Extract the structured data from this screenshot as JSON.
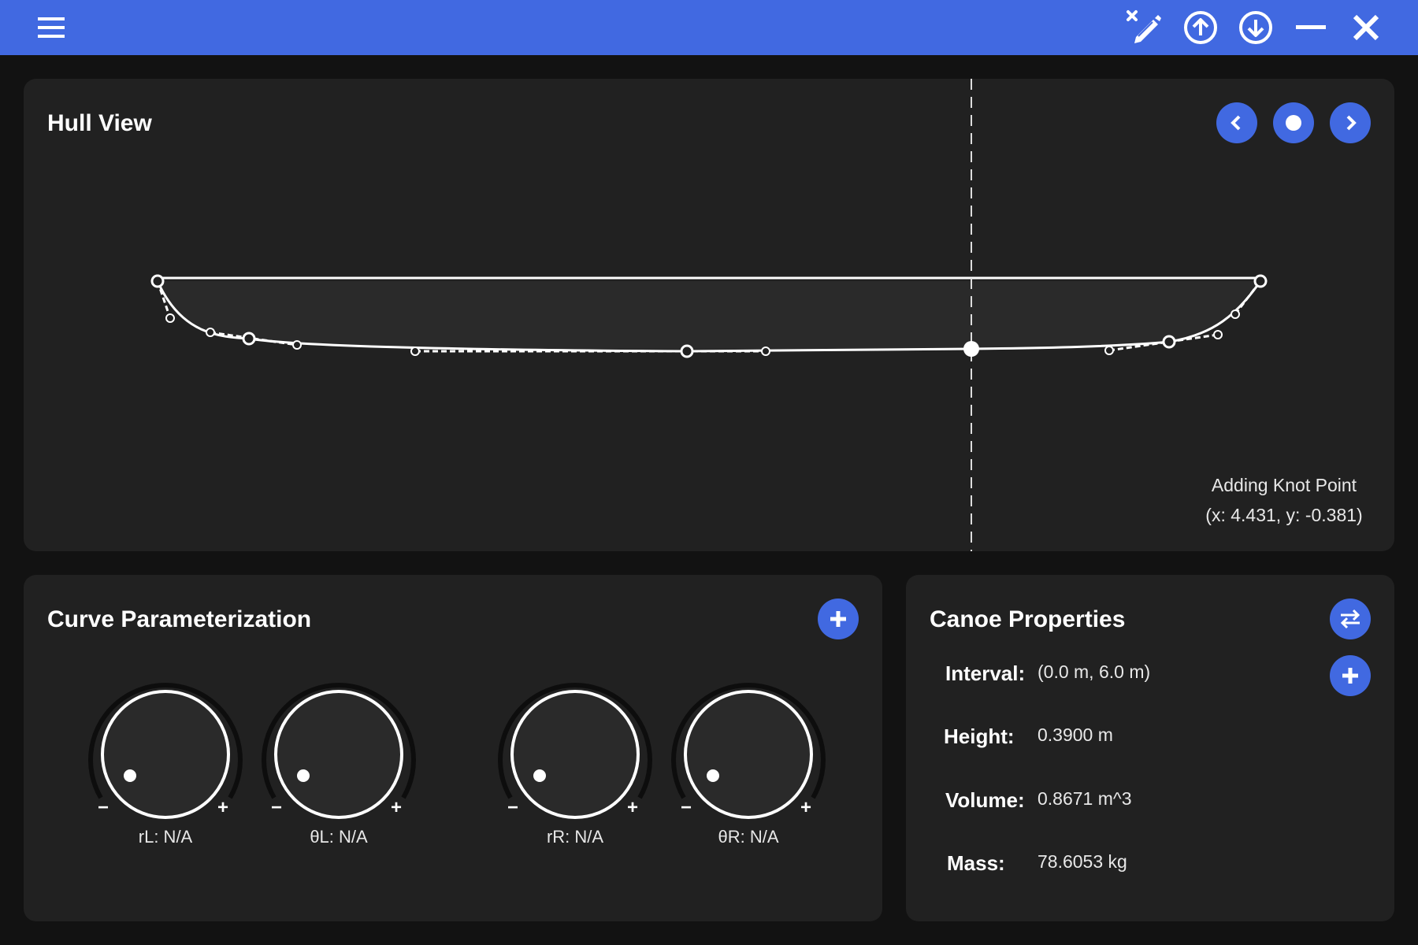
{
  "toolbar": {
    "icons": [
      "menu-icon",
      "edit-off-icon",
      "upload-icon",
      "download-icon",
      "minimize-icon",
      "close-icon"
    ]
  },
  "hull_view": {
    "title": "Hull View",
    "nav": [
      "chevron-left-icon",
      "dot-icon",
      "chevron-right-icon"
    ],
    "status_line1": "Adding Knot Point",
    "status_line2": "(x: 4.431, y: -0.381)"
  },
  "curve_param": {
    "title": "Curve Parameterization",
    "knobs": [
      {
        "label": "rL: N/A",
        "minus": "−",
        "plus": "+"
      },
      {
        "label": "θL: N/A",
        "minus": "−",
        "plus": "+"
      },
      {
        "label": "rR: N/A",
        "minus": "−",
        "plus": "+"
      },
      {
        "label": "θR: N/A",
        "minus": "−",
        "plus": "+"
      }
    ]
  },
  "canoe_props": {
    "title": "Canoe Properties",
    "rows": [
      {
        "label": "Interval:",
        "value": "(0.0 m, 6.0 m)"
      },
      {
        "label": "Height:",
        "value": "0.3900 m"
      },
      {
        "label": "Volume:",
        "value": "0.8671 m^3"
      },
      {
        "label": "Mass:",
        "value": "78.6053 kg"
      }
    ]
  },
  "colors": {
    "accent": "#4169e1",
    "panel": "#212121",
    "background": "#121212"
  }
}
